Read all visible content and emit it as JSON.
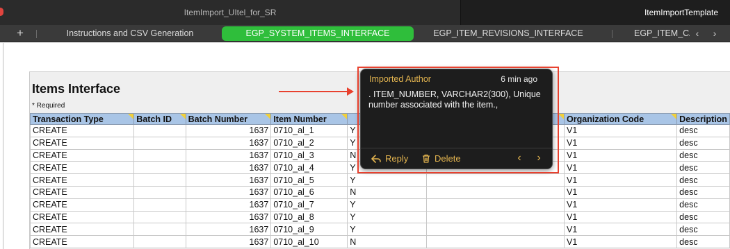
{
  "window": {
    "file_tabs": [
      {
        "label": "ItemImport_UItel_for_SR",
        "active": false
      },
      {
        "label": "ItemImportTemplate",
        "active": true
      }
    ]
  },
  "sheet_bar": {
    "add_label": "+",
    "tabs": [
      {
        "label": "Instructions and CSV Generation",
        "active": false
      },
      {
        "label": "EGP_SYSTEM_ITEMS_INTERFACE",
        "active": true
      },
      {
        "label": "EGP_ITEM_REVISIONS_INTERFACE",
        "active": false
      },
      {
        "label": "EGP_ITEM_CATEGORIES_INTERFACE",
        "active": false
      }
    ],
    "prev_arrow": "‹",
    "next_arrow": "›",
    "active_color": "#2fbe3b"
  },
  "sheet": {
    "title": "Items Interface",
    "required_note": "* Required",
    "columns": [
      "Transaction Type",
      "Batch ID",
      "Batch Number",
      "Item Number",
      "",
      "",
      "Organization Code",
      "Description"
    ],
    "rows": [
      [
        "CREATE",
        "",
        "1637",
        "0710_al_1",
        "Y",
        "",
        "V1",
        "desc"
      ],
      [
        "CREATE",
        "",
        "1637",
        "0710_al_2",
        "Y",
        "",
        "V1",
        "desc"
      ],
      [
        "CREATE",
        "",
        "1637",
        "0710_al_3",
        "N",
        "",
        "V1",
        "desc"
      ],
      [
        "CREATE",
        "",
        "1637",
        "0710_al_4",
        "Y",
        "",
        "V1",
        "desc"
      ],
      [
        "CREATE",
        "",
        "1637",
        "0710_al_5",
        "Y",
        "",
        "V1",
        "desc"
      ],
      [
        "CREATE",
        "",
        "1637",
        "0710_al_6",
        "N",
        "",
        "V1",
        "desc"
      ],
      [
        "CREATE",
        "",
        "1637",
        "0710_al_7",
        "Y",
        "",
        "V1",
        "desc"
      ],
      [
        "CREATE",
        "",
        "1637",
        "0710_al_8",
        "Y",
        "",
        "V1",
        "desc"
      ],
      [
        "CREATE",
        "",
        "1637",
        "0710_al_9",
        "Y",
        "",
        "V1",
        "desc"
      ],
      [
        "CREATE",
        "",
        "1637",
        "0710_al_10",
        "N",
        "",
        "V1",
        "desc"
      ]
    ]
  },
  "comment": {
    "author": "Imported Author",
    "time": "6 min ago",
    "body": ". ITEM_NUMBER, VARCHAR2(300), Unique number associated with the item.,",
    "reply_label": "Reply",
    "reply_icon": "reply-arrow-icon",
    "delete_label": "Delete",
    "delete_icon": "trash-icon",
    "prev": "‹",
    "next": "›",
    "accent_color": "#e3b44f"
  },
  "annotation": {
    "color": "#e8412e"
  }
}
